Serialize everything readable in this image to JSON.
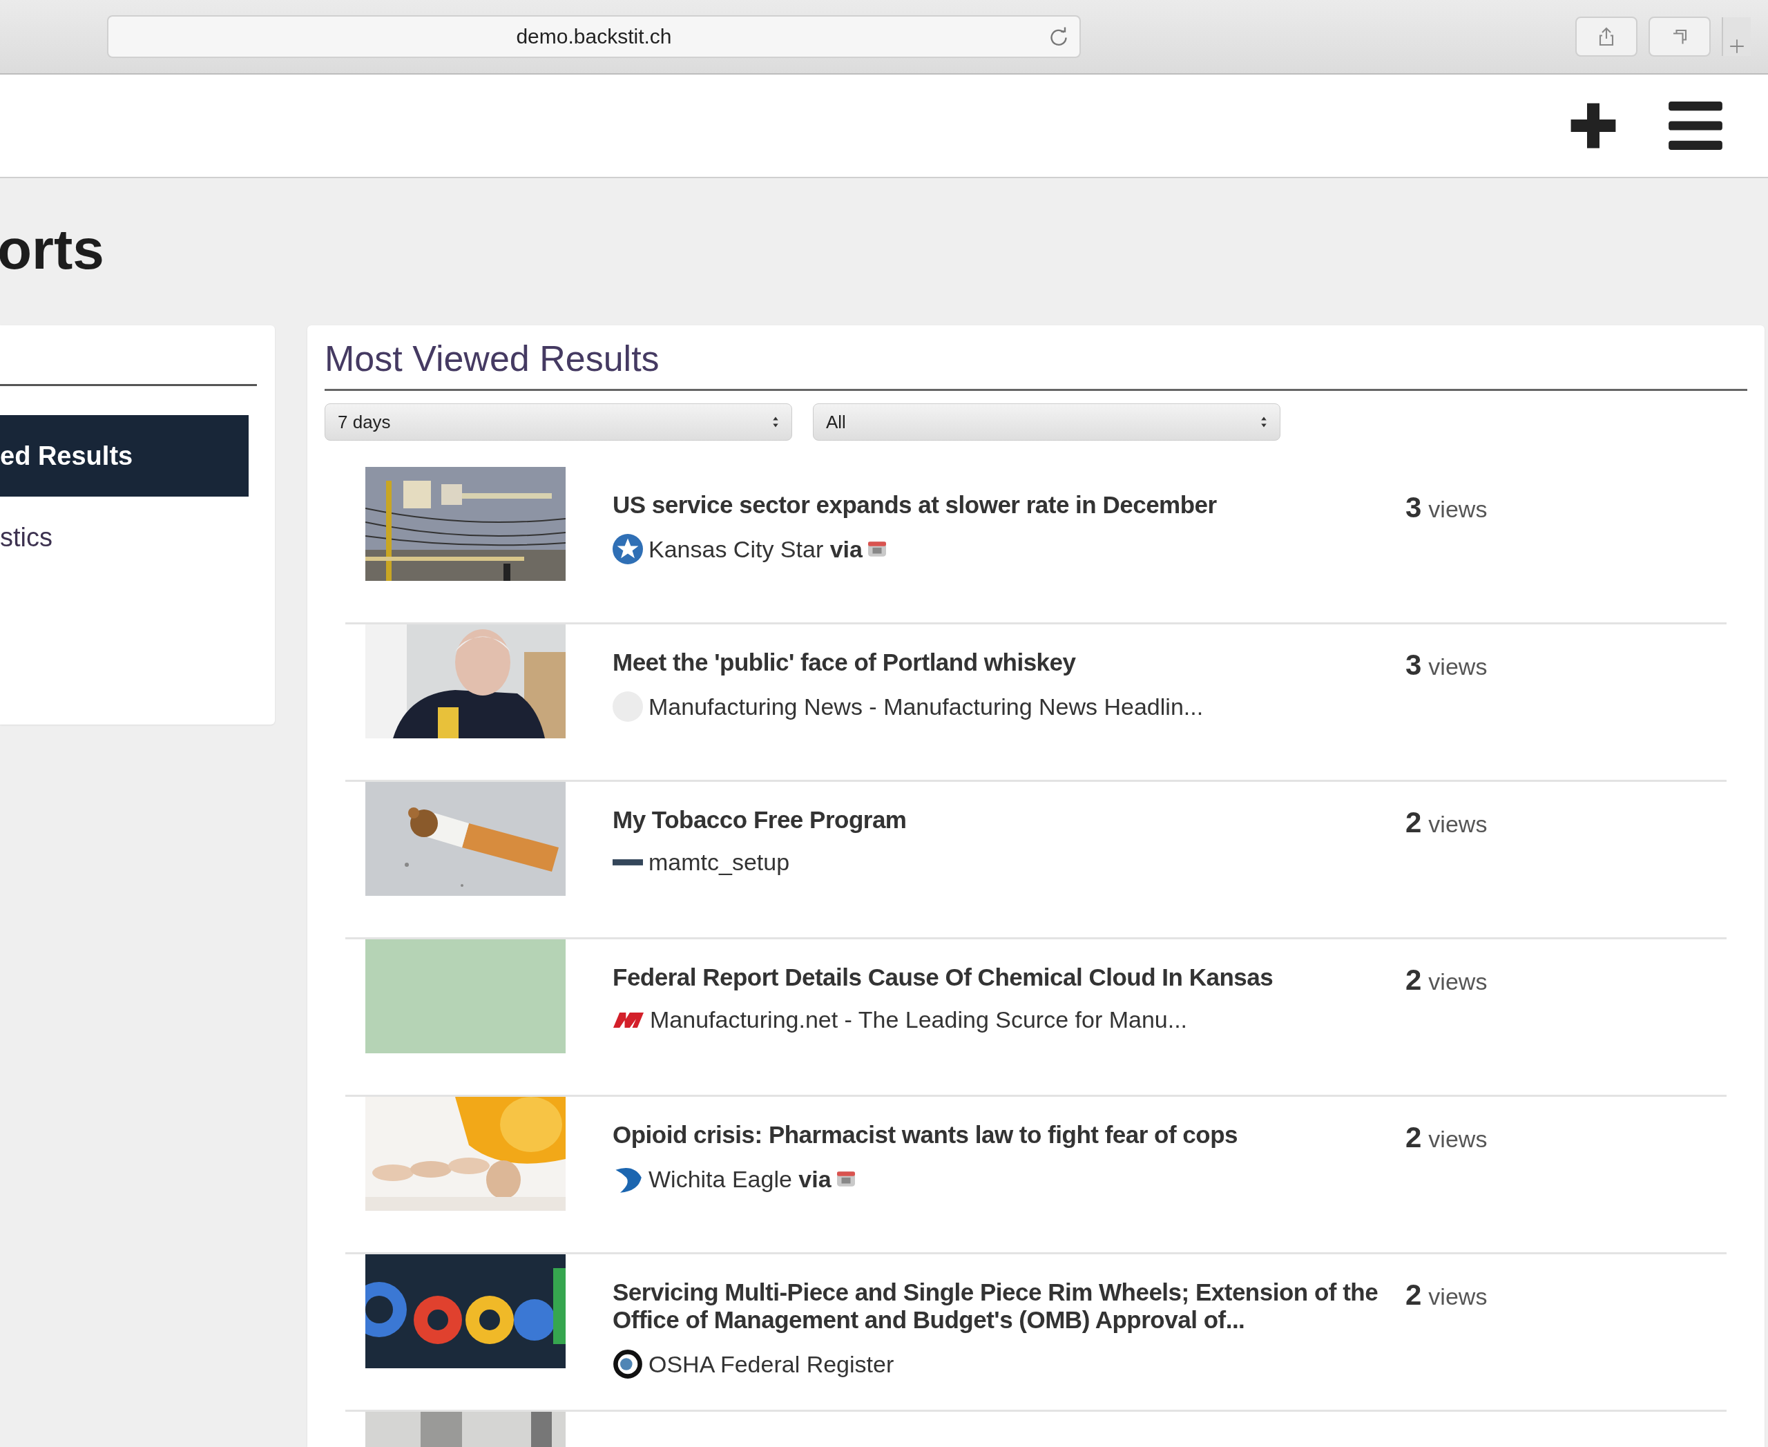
{
  "browser": {
    "address": "demo.backstit.ch"
  },
  "page_title": "orts",
  "sidebar": {
    "items": [
      {
        "label": "ed Results",
        "selected": true
      },
      {
        "label": "stics",
        "selected": false
      }
    ]
  },
  "panel": {
    "title": "Most Viewed Results",
    "filters": [
      {
        "value": "7 days"
      },
      {
        "value": "All"
      }
    ],
    "results": [
      {
        "kind": "picture",
        "title": "US service sector expands at slower rate in December",
        "source": "Kansas City Star **via**",
        "logo": {
          "kind": "star"
        },
        "via_badge": true,
        "views": "3",
        "views_label": "views"
      },
      {
        "kind": "picture",
        "title": "Meet the 'public' face of Portland whiskey",
        "source": "Manufacturing News - Manufacturing News Headlin...",
        "logo": {
          "kind": "blank"
        },
        "via_badge": false,
        "views": "3",
        "views_label": "views"
      },
      {
        "kind": "picture",
        "title": "My Tobacco Free Program",
        "source": "mamtc_setup",
        "logo": {
          "kind": "dash"
        },
        "via_badge": false,
        "views": "2",
        "views_label": "views"
      },
      {
        "kind": "picture",
        "title": "Federal Report Details Cause Of Chemical Cloud In Kansas",
        "source": "Manufacturing.net - The Leading Scurce for Manu...",
        "logo": {
          "kind": "m"
        },
        "via_badge": false,
        "views": "2",
        "views_label": "views"
      },
      {
        "kind": "picture",
        "title": "Opioid crisis: Pharmacist wants law to fight fear of cops",
        "source": "Wichita Eagle **via**",
        "logo": {
          "kind": "bird"
        },
        "via_badge": true,
        "views": "2",
        "views_label": "views"
      },
      {
        "kind": "picture",
        "title": "Servicing Multi-Piece and Single Piece Rim Wheels; Extension of the Office of Management and Budget's (OMB) Approval of...",
        "source": "OSHA Federal Register",
        "logo": {
          "kind": "ring"
        },
        "via_badge": false,
        "views": "2",
        "views_label": "views"
      },
      {
        "kind": "picture"
      }
    ]
  }
}
